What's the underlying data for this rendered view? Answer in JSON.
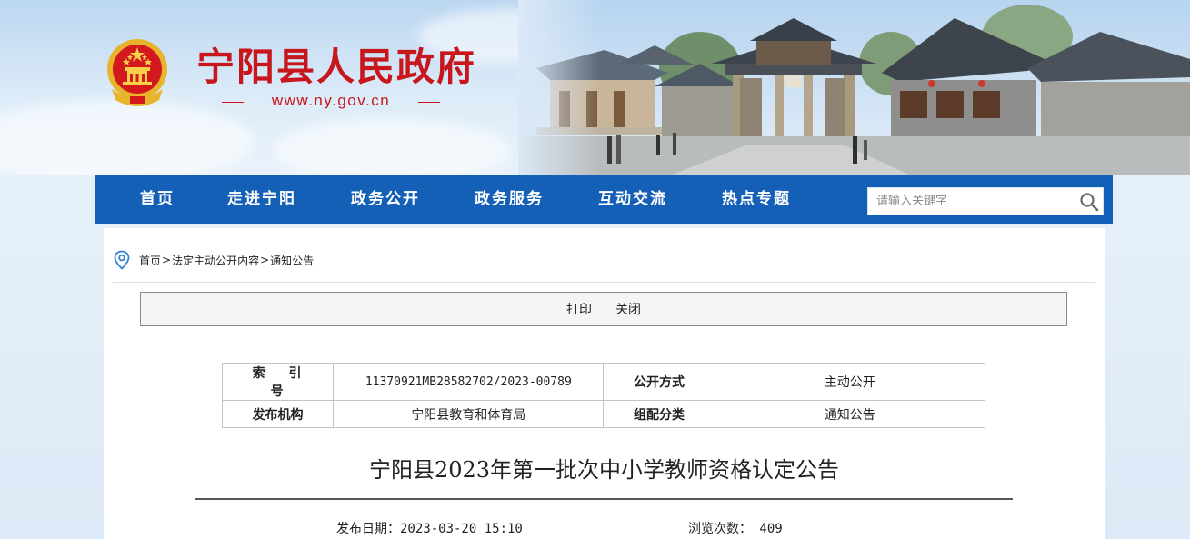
{
  "site": {
    "title": "宁阳县人民政府",
    "url": "www.ny.gov.cn"
  },
  "nav": {
    "items": [
      "首页",
      "走进宁阳",
      "政务公开",
      "政务服务",
      "互动交流",
      "热点专题"
    ],
    "search_placeholder": "请输入关键字"
  },
  "breadcrumb": {
    "home": "首页",
    "sep": ">",
    "level1": "法定主动公开内容",
    "level2": "通知公告"
  },
  "toolbar": {
    "print": "打印",
    "close": "关闭"
  },
  "meta": {
    "index_label": "索引号",
    "index_value": "11370921MB28582702/2023-00789",
    "disclosure_label": "公开方式",
    "disclosure_value": "主动公开",
    "publisher_label": "发布机构",
    "publisher_value": "宁阳县教育和体育局",
    "category_label": "组配分类",
    "category_value": "通知公告"
  },
  "article": {
    "title": "宁阳县2023年第一批次中小学教师资格认定公告",
    "publish_date": "发布日期：2023-03-20 15:10",
    "views": "浏览次数： 409"
  },
  "colors": {
    "nav_blue": "#1560b7",
    "brand_red": "#c8161d"
  },
  "icons": {
    "emblem": "national-emblem-icon",
    "search": "search-icon",
    "location": "location-pin-icon"
  }
}
